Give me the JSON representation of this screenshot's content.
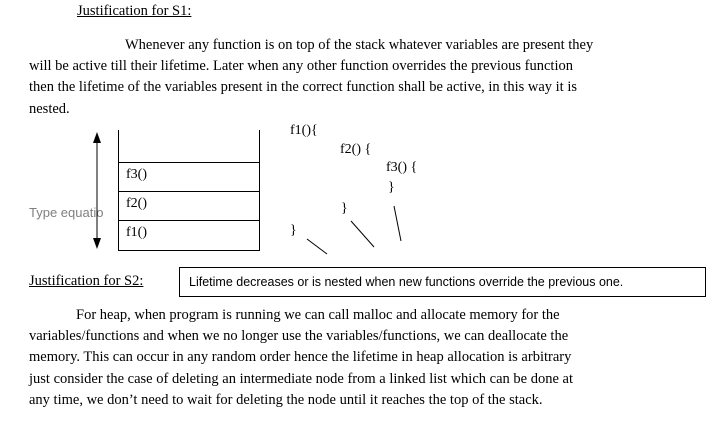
{
  "s1": {
    "heading": "Justification for S1:",
    "lines": [
      "Whenever any function is on top of the stack whatever variables are present they",
      "will be active till their lifetime. Later when any other function overrides the previous function",
      "then the lifetime of the variables present in the correct function shall be active, in this way it is",
      "nested."
    ]
  },
  "stack": {
    "items": [
      "f3()",
      "f2()",
      "f1()"
    ]
  },
  "code": {
    "f1_open": "f1(){",
    "f2_open": "f2() {",
    "f3_open": "f3() {",
    "f3_close": "}",
    "f2_close": "}",
    "f1_close": "}"
  },
  "equation_placeholder": "Type equation here.",
  "s2": {
    "heading": "Justification for S2:",
    "answer": "Lifetime decreases or is nested when new functions override the previous one.",
    "lines": [
      "For heap, when program is running we can call malloc and allocate memory for the",
      "variables/functions and when we no longer use the variables/functions, we can deallocate the",
      "memory. This can occur in any random order hence the lifetime in heap allocation is arbitrary",
      "just consider the case of deleting an intermediate node from a linked list which can be done at",
      "any time, we don’t need to wait for deleting the node until it reaches the top of the stack."
    ]
  }
}
